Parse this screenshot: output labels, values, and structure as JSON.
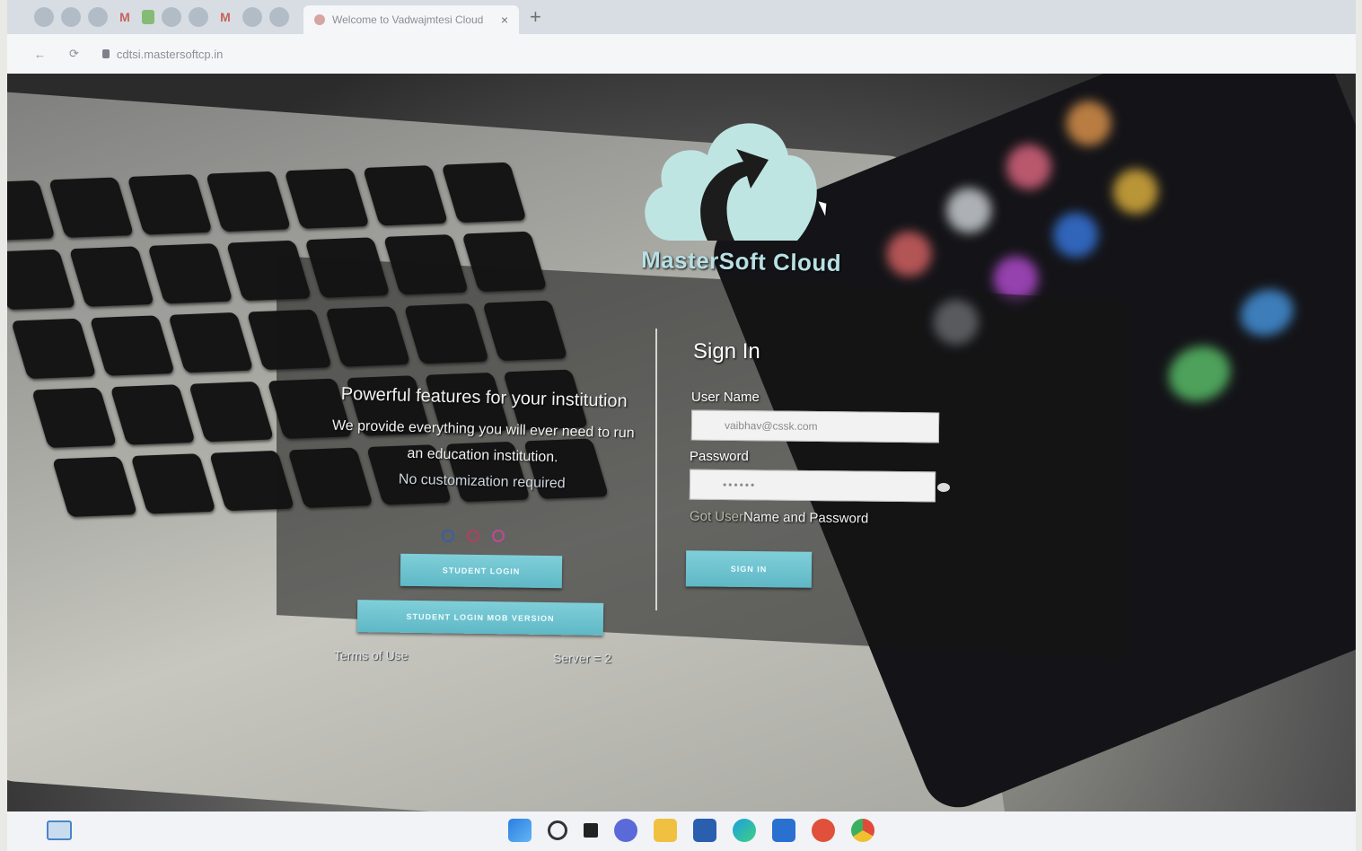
{
  "browser": {
    "tab_title": "Welcome to Vadwajmtesi Cloud",
    "close_tab": "×",
    "new_tab": "+",
    "back": "←",
    "reload": "⟳",
    "url": "cdtsi.mastersoftcp.in"
  },
  "page": {
    "brand": "MasterSoft Cloud",
    "features_heading": "Powerful features for your institution",
    "features_line1": "We provide everything you will ever need to run an education institution.",
    "features_line2": "No customization required",
    "student_login_label": "STUDENT LOGIN",
    "student_mobile_label": "STUDENT LOGIN MOB VERSION",
    "terms_label": "Terms of Use",
    "server_label": "Server = 2"
  },
  "signin": {
    "title": "Sign In",
    "username_label": "User Name",
    "username_value": "vaibhav@cssk.com",
    "password_label": "Password",
    "password_value": "••••••",
    "forgot_prefix": "Got ",
    "forgot_highlight": "User",
    "forgot_rest": "Name and Password",
    "signin_button": "SIGN IN"
  },
  "colors": {
    "accent_teal": "#6cc3cf",
    "brand_text": "#b7e0e4"
  },
  "icons": [
    "arrow-back-icon",
    "reload-icon",
    "lock-icon",
    "star-icon",
    "windows-start-icon",
    "search-icon",
    "file-explorer-icon",
    "chrome-icon",
    "edge-icon"
  ]
}
